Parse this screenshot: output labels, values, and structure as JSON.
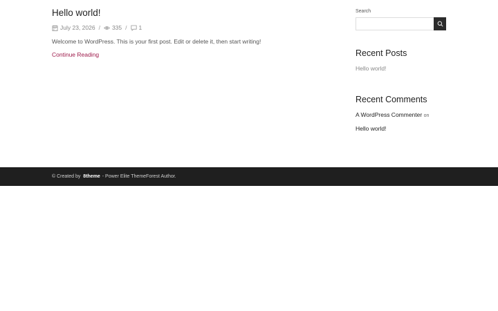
{
  "post": {
    "title": "Hello world!",
    "date": "July 23, 2026",
    "views": "335",
    "comments": "1",
    "separator": "/",
    "excerpt": "Welcome to WordPress. This is your first post. Edit or delete it, then start writing!",
    "continue_label": "Continue Reading",
    "icons": {
      "date": "calendar-icon",
      "views": "eye-icon",
      "comments": "comment-icon"
    }
  },
  "sidebar": {
    "search": {
      "label": "Search",
      "value": "",
      "placeholder": "",
      "button_icon": "search-icon"
    },
    "recent_posts": {
      "title": "Recent Posts",
      "items": [
        "Hello world!"
      ]
    },
    "recent_comments": {
      "title": "Recent Comments",
      "items": [
        {
          "author": "A WordPress Commenter",
          "connector": "on",
          "post": "Hello world!"
        }
      ]
    }
  },
  "footer": {
    "prefix": "© Created by",
    "brand": "8theme",
    "suffix": "- Power Elite ThemeForest Author."
  },
  "colors": {
    "accent": "#9e1b4b",
    "footer_bg": "#1f1f1f",
    "search_button_bg": "#2b2b2b"
  }
}
